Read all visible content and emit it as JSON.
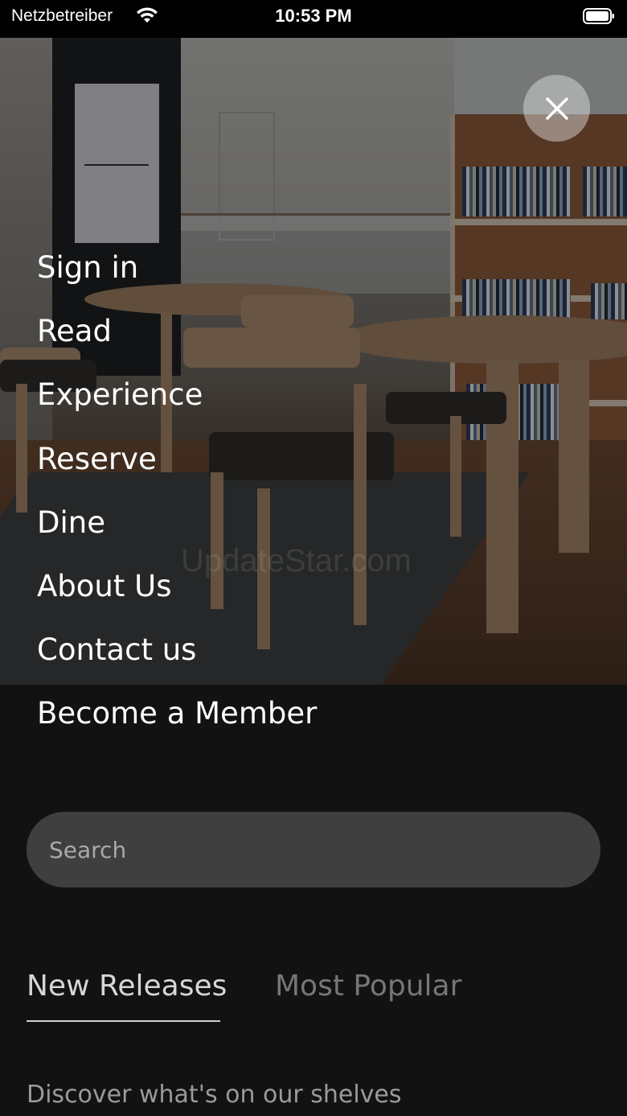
{
  "status_bar": {
    "carrier": "Netzbetreiber",
    "time": "10:53 PM"
  },
  "menu": {
    "items": [
      {
        "label": "Sign in"
      },
      {
        "label": "Read"
      },
      {
        "label": "Experience"
      },
      {
        "label": "Reserve"
      },
      {
        "label": "Dine"
      },
      {
        "label": "About Us"
      },
      {
        "label": "Contact us"
      },
      {
        "label": "Become a Member"
      }
    ]
  },
  "search": {
    "placeholder": "Search"
  },
  "tabs": [
    {
      "label": "New Releases",
      "active": true
    },
    {
      "label": "Most Popular",
      "active": false
    }
  ],
  "section": {
    "subtitle": "Discover what's on our shelves"
  },
  "watermark": "UpdateStar.com",
  "colors": {
    "background": "#121212",
    "search_bg": "#3f3f3f",
    "tab_active": "#d6d6d6",
    "tab_inactive": "#767676"
  }
}
